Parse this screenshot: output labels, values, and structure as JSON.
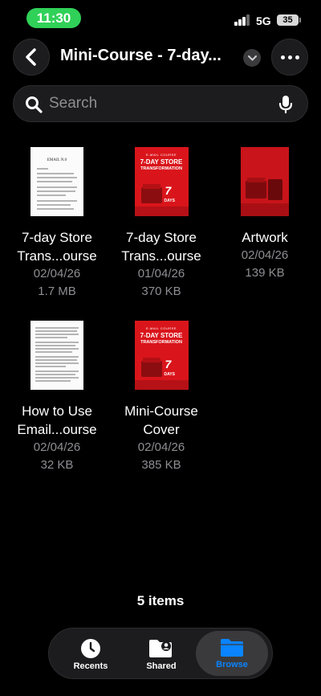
{
  "status_bar": {
    "time": "11:30",
    "network": "5G",
    "battery": "35"
  },
  "nav": {
    "title": "Mini-Course - 7-day..."
  },
  "search": {
    "placeholder": "Search"
  },
  "files": [
    {
      "name_line1": "7-day Store",
      "name_line2": "Trans...ourse",
      "date": "02/04/26",
      "size": "1.7 MB",
      "thumb": "document"
    },
    {
      "name_line1": "7-day Store",
      "name_line2": "Trans...ourse",
      "date": "01/04/26",
      "size": "370 KB",
      "thumb": "cover"
    },
    {
      "name_line1": "Artwork",
      "name_line2": "",
      "date": "02/04/26",
      "size": "139 KB",
      "thumb": "artwork"
    },
    {
      "name_line1": "How to Use",
      "name_line2": "Email...ourse",
      "date": "02/04/26",
      "size": "32 KB",
      "thumb": "document"
    },
    {
      "name_line1": "Mini-Course",
      "name_line2": "Cover",
      "date": "02/04/26",
      "size": "385 KB",
      "thumb": "cover"
    }
  ],
  "thumb_text": {
    "doc_heading": "EMAIL N.0",
    "cover_kicker": "E-MAIL COURSE",
    "cover_title_1": "7-DAY STORE",
    "cover_title_2": "TRANSFORMATION",
    "cover_days_num": "7",
    "cover_days_word": "DAYS"
  },
  "footer": {
    "item_count": "5 items"
  },
  "tabs": [
    {
      "label": "Recents",
      "icon": "clock-icon",
      "active": false
    },
    {
      "label": "Shared",
      "icon": "shared-folder-icon",
      "active": false
    },
    {
      "label": "Browse",
      "icon": "folder-icon",
      "active": true
    }
  ],
  "colors": {
    "accent": "#0a84ff",
    "time_pill": "#30d158",
    "cover_red": "#d9151b",
    "background": "#000000"
  }
}
